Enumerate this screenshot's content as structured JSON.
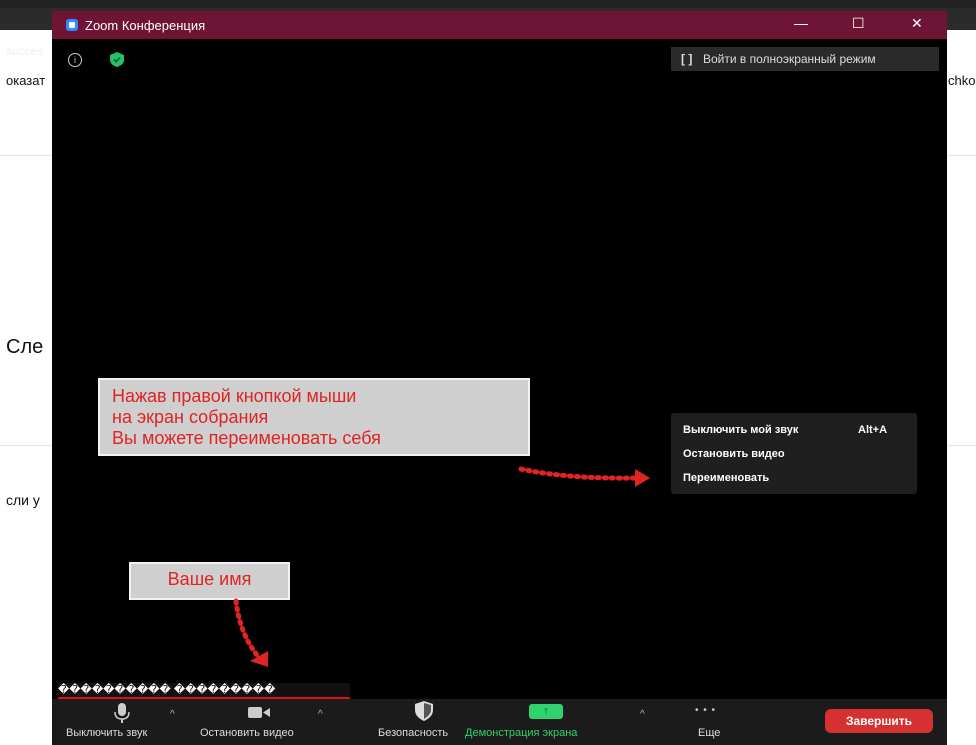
{
  "background": {
    "tab_fragment_left": "succes",
    "tab_fragment_left2": "оказат",
    "tab_fragment_right": "chko",
    "page_text_1": "Сле",
    "page_text_2": "сли у"
  },
  "window": {
    "title": "Zoom Конференция",
    "minimize_glyph": "—",
    "maximize_glyph": "☐",
    "close_glyph": "✕"
  },
  "meeting": {
    "info_glyph": "i",
    "fullscreen_label": "Войти в полноэкранный режим"
  },
  "callouts": {
    "rename_hint": [
      "Нажав правой кнопкой мыши",
      "на экран собрания",
      "Вы можете переименовать себя"
    ],
    "your_name": "Ваше имя"
  },
  "context_menu": {
    "items": [
      {
        "label": "Выключить мой звук",
        "shortcut": "Alt+A"
      },
      {
        "label": "Остановить видео",
        "shortcut": ""
      },
      {
        "label": "Переименовать",
        "shortcut": ""
      }
    ]
  },
  "participant_name": "���������� ���������",
  "toolbar": {
    "mute_label": "Выключить звук",
    "video_label": "Остановить видео",
    "security_label": "Безопасность",
    "share_label": "Демонстрация экрана",
    "more_label": "Еще",
    "end_label": "Завершить",
    "caret": "^",
    "more_glyph": "• • •"
  },
  "colors": {
    "titlebar": "#6e1434",
    "share_green": "#2fd26c",
    "end_red": "#d63131",
    "callout_text": "#e02424"
  }
}
